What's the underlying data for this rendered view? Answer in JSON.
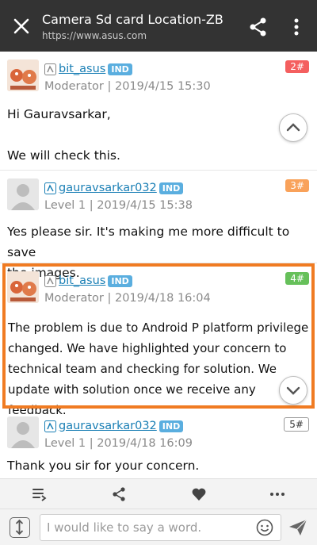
{
  "header": {
    "title": "Camera Sd card Location-ZB…",
    "url": "https://www.asus.com"
  },
  "posts": [
    {
      "username": "bit_asus",
      "badge": "IND",
      "role": "Moderator",
      "date": "2019/4/15 15:30",
      "floor": "2#",
      "lines": [
        "Hi Gauravsarkar,",
        "",
        "We will check this."
      ]
    },
    {
      "username": "gauravsarkar032",
      "badge": "IND",
      "role": "Level 1",
      "date": "2019/4/15 15:38",
      "floor": "3#",
      "lines": [
        "Yes please sir. It's making me more difficult to save",
        "the images."
      ]
    },
    {
      "username": "bit_asus",
      "badge": "IND",
      "role": "Moderator",
      "date": "2019/4/18 16:04",
      "floor": "4#",
      "lines": [
        "The problem is due to Android P platform privilege",
        "changed. We have highlighted your concern to",
        "technical team and checking for solution. We",
        "update with solution once we receive any feedback."
      ]
    },
    {
      "username": "gauravsarkar032",
      "badge": "IND",
      "role": "Level 1",
      "date": "2019/4/18 16:09",
      "floor": "5#",
      "lines": [
        "Thank you sir for your concern."
      ]
    }
  ],
  "reply": {
    "placeholder": "I would like to say a word."
  },
  "colors": {
    "topbar": "#333333",
    "highlight": "#f07b22",
    "link": "#1a7fb5",
    "badge": "#5aaedf"
  }
}
